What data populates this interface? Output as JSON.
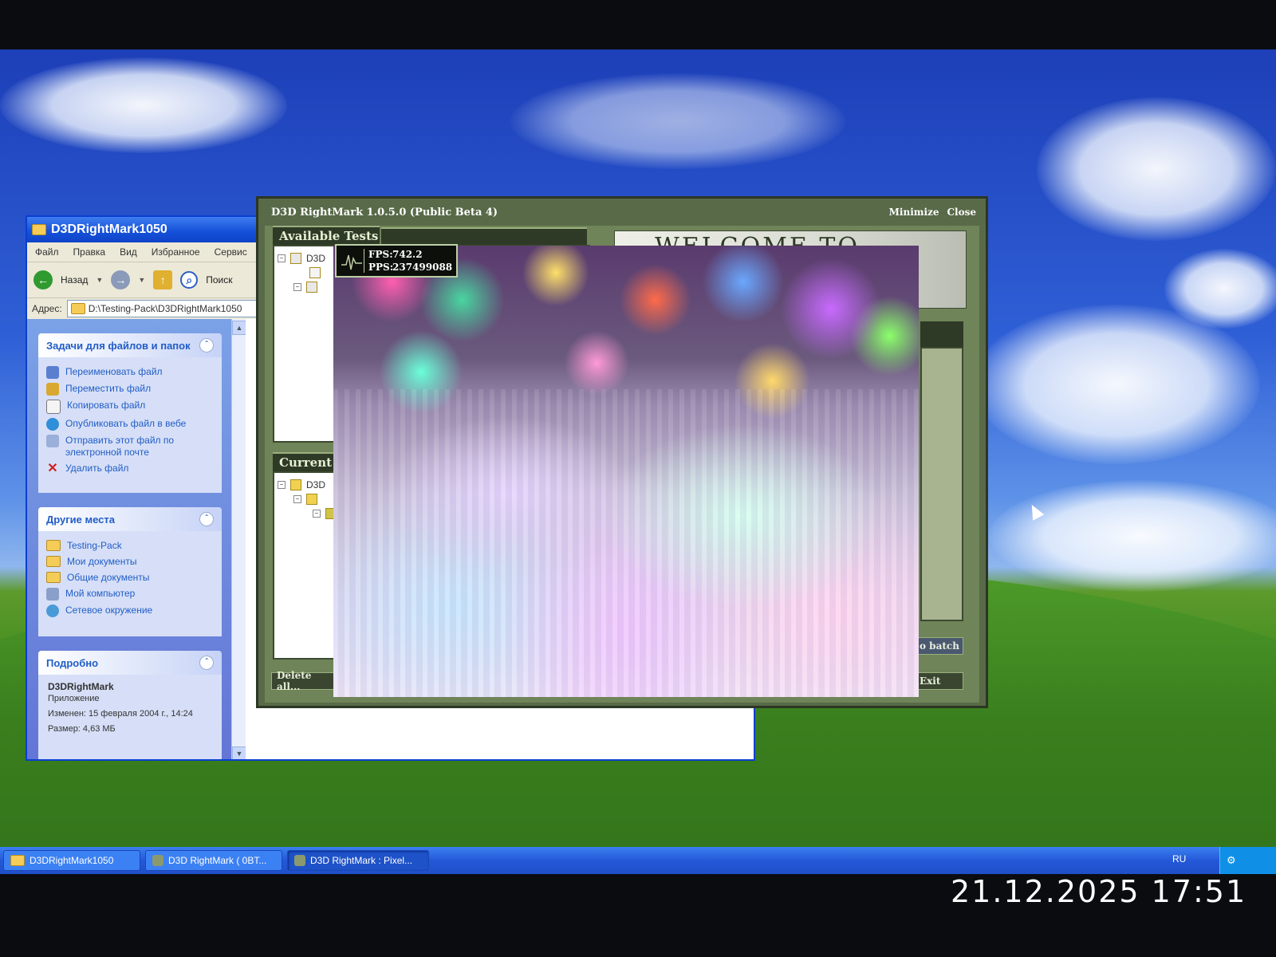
{
  "explorer": {
    "title": "D3DRightMark1050",
    "menu": [
      "Файл",
      "Правка",
      "Вид",
      "Избранное",
      "Сервис"
    ],
    "toolbar": {
      "back_label": "Назад",
      "search_label": "Поиск"
    },
    "address": {
      "label": "Адрес:",
      "value": "D:\\Testing-Pack\\D3DRightMark1050"
    },
    "tasks": {
      "title": "Задачи для файлов и папок",
      "items": [
        {
          "label": "Переименовать файл",
          "icon": "rename-icon"
        },
        {
          "label": "Переместить файл",
          "icon": "move-icon"
        },
        {
          "label": "Копировать файл",
          "icon": "copy-icon"
        },
        {
          "label": "Опубликовать файл в вебе",
          "icon": "globe-icon"
        },
        {
          "label": "Отправить этот файл по электронной почте",
          "icon": "mail-icon"
        },
        {
          "label": "Удалить файл",
          "icon": "delete-icon"
        }
      ]
    },
    "places": {
      "title": "Другие места",
      "items": [
        {
          "label": "Testing-Pack",
          "icon": "folder-icon"
        },
        {
          "label": "Мои документы",
          "icon": "folder-icon"
        },
        {
          "label": "Общие документы",
          "icon": "folder-icon"
        },
        {
          "label": "Мой компьютер",
          "icon": "computer-icon"
        },
        {
          "label": "Сетевое окружение",
          "icon": "network-icon"
        }
      ]
    },
    "details": {
      "title": "Подробно",
      "name": "D3DRightMark",
      "type": "Приложение",
      "modified": "Изменен: 15 февраля 2004 г., 14:24",
      "size": "Размер: 4,63 МБ"
    }
  },
  "d3d": {
    "title": "D3D RightMark 1.0.5.0 (Public Beta 4)",
    "minimize_label": "Minimize",
    "close_label": "Close",
    "available_tab": "Available Tests",
    "current_tab": "Current",
    "tree_label": "D3D",
    "welcome_text": "WELCOME TO",
    "delete_all_label": "Delete all...",
    "batch_label": "o batch",
    "exit_label": "Exit",
    "fps": {
      "fps_label": "FPS:",
      "fps_value": "742.2",
      "pps_label": "PPS:",
      "pps_value": "237499088"
    }
  },
  "taskbar": {
    "items": [
      {
        "label": "D3DRightMark1050",
        "active": false
      },
      {
        "label": "D3D RightMark ( 0BT...",
        "active": false
      },
      {
        "label": "D3D RightMark : Pixel...",
        "active": true
      }
    ],
    "language": "RU"
  },
  "photo_timestamp": "21.12.2025 17:51",
  "colors": {
    "xp_blue": "#1450d8",
    "d3d_olive": "#586a48",
    "panel_blue": "#215dc6"
  }
}
